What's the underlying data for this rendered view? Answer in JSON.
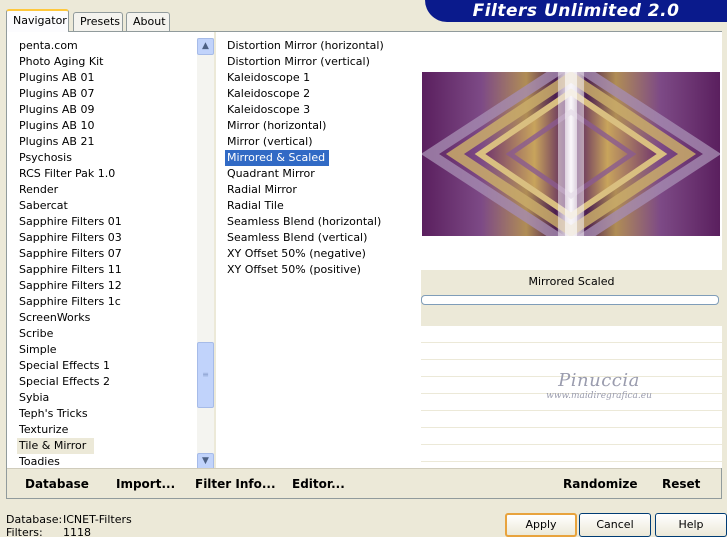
{
  "window": {
    "title": "Filters Unlimited 2.0"
  },
  "tabs": [
    {
      "label": "Navigator",
      "active": true
    },
    {
      "label": "Presets",
      "active": false
    },
    {
      "label": "About",
      "active": false
    }
  ],
  "categories": {
    "items": [
      "penta.com",
      "Photo Aging Kit",
      "Plugins AB 01",
      "Plugins AB 07",
      "Plugins AB 09",
      "Plugins AB 10",
      "Plugins AB 21",
      "Psychosis",
      "RCS Filter Pak 1.0",
      "Render",
      "Sabercat",
      "Sapphire Filters 01",
      "Sapphire Filters 03",
      "Sapphire Filters 07",
      "Sapphire Filters 11",
      "Sapphire Filters 12",
      "Sapphire Filters 1c",
      "ScreenWorks",
      "Scribe",
      "Simple",
      "Special Effects 1",
      "Special Effects 2",
      "Sybia",
      "Teph's Tricks",
      "Texturize",
      "Tile & Mirror",
      "Toadies"
    ],
    "selected": "Tile & Mirror"
  },
  "filters": {
    "items": [
      "Distortion Mirror (horizontal)",
      "Distortion Mirror (vertical)",
      "Kaleidoscope 1",
      "Kaleidoscope 2",
      "Kaleidoscope 3",
      "Mirror (horizontal)",
      "Mirror (vertical)",
      "Mirrored & Scaled",
      "Quadrant Mirror",
      "Radial Mirror",
      "Radial Tile",
      "Seamless Blend (horizontal)",
      "Seamless Blend (vertical)",
      "XY Offset 50% (negative)",
      "XY Offset 50% (positive)"
    ],
    "selected": "Mirrored & Scaled"
  },
  "preview": {
    "status_text": "Mirrored  Scaled",
    "watermark_name": "Pinuccia",
    "watermark_url": "www.maidiregrafica.eu"
  },
  "toolbar": {
    "database": "Database",
    "import": "Import...",
    "filter_info": "Filter Info...",
    "editor": "Editor...",
    "randomize": "Randomize",
    "reset": "Reset"
  },
  "info": {
    "database_label": "Database:",
    "database_value": "ICNET-Filters",
    "filters_label": "Filters:",
    "filters_value": "1118"
  },
  "buttons": {
    "apply": "Apply",
    "cancel": "Cancel",
    "help": "Help"
  },
  "colors": {
    "banner": "#0a1a8c",
    "selection": "#316ac5",
    "dialog_bg": "#ece9d8"
  }
}
